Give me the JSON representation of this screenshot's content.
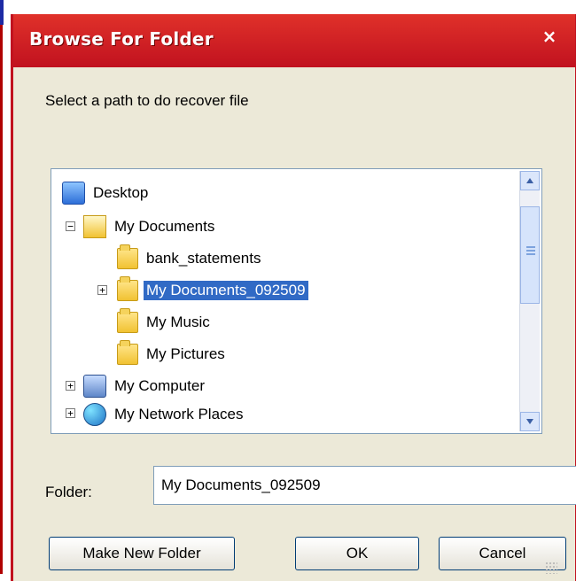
{
  "window": {
    "title": "Browse For Folder",
    "close_symbol": "×"
  },
  "instructions": "Select a path to do recover file",
  "tree": {
    "items": [
      {
        "label": "Desktop",
        "icon": "desktop-icon"
      },
      {
        "label": "My Documents",
        "icon": "my-documents-icon",
        "expander": "−"
      },
      {
        "label": "bank_statements",
        "icon": "folder-icon"
      },
      {
        "label": "My Documents_092509",
        "icon": "folder-icon",
        "expander": "+",
        "selected": true
      },
      {
        "label": "My Music",
        "icon": "music-folder-icon"
      },
      {
        "label": "My Pictures",
        "icon": "pictures-folder-icon"
      },
      {
        "label": "My Computer",
        "icon": "computer-icon",
        "expander": "+"
      },
      {
        "label": "My Network Places",
        "icon": "network-icon",
        "expander": "+"
      }
    ]
  },
  "folder": {
    "label": "Folder:",
    "value": "My Documents_092509"
  },
  "buttons": {
    "make": "Make New Folder",
    "ok": "OK",
    "cancel": "Cancel"
  },
  "colors": {
    "title_bar": "#c1121f",
    "selection": "#316ac5",
    "dialog_bg": "#ece9d8"
  }
}
